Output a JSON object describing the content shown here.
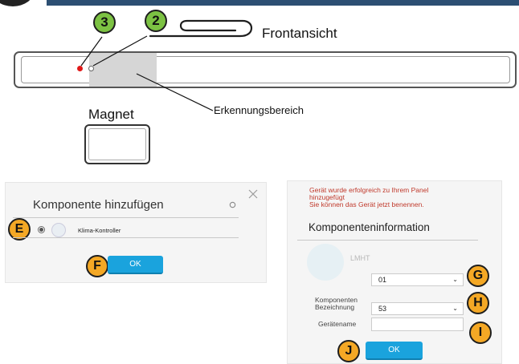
{
  "diagram": {
    "front_view_label": "Frontansicht",
    "detection_label": "Erkennungsbereich",
    "magnet_label": "Magnet",
    "badge_3": "3",
    "badge_2": "2"
  },
  "add_dialog": {
    "title": "Komponente hinzufügen",
    "component_name": "Klima-Kontroller",
    "ok_label": "OK",
    "badge_e": "E",
    "badge_f": "F"
  },
  "info_dialog": {
    "success_line1": "Gerät wurde erfolgreich zu Ihrem Panel",
    "success_line2": "hinzugefügt",
    "success_line3": "Sie können das Gerät jetzt benennen.",
    "title": "Komponenteninformation",
    "device_code": "LMHT",
    "field1_value": "01",
    "field2_label_line1": "Komponenten",
    "field2_label_line2": "Bezeichnung",
    "field2_value": "53",
    "device_name_label": "Gerätename",
    "device_name_value": "",
    "ok_label": "OK",
    "badge_g": "G",
    "badge_h": "H",
    "badge_i": "I",
    "badge_j": "J"
  },
  "colors": {
    "accent_blue": "#1aa3dd",
    "badge_green": "#7cc243",
    "badge_orange": "#f4a825",
    "error_red": "#c0392b"
  }
}
